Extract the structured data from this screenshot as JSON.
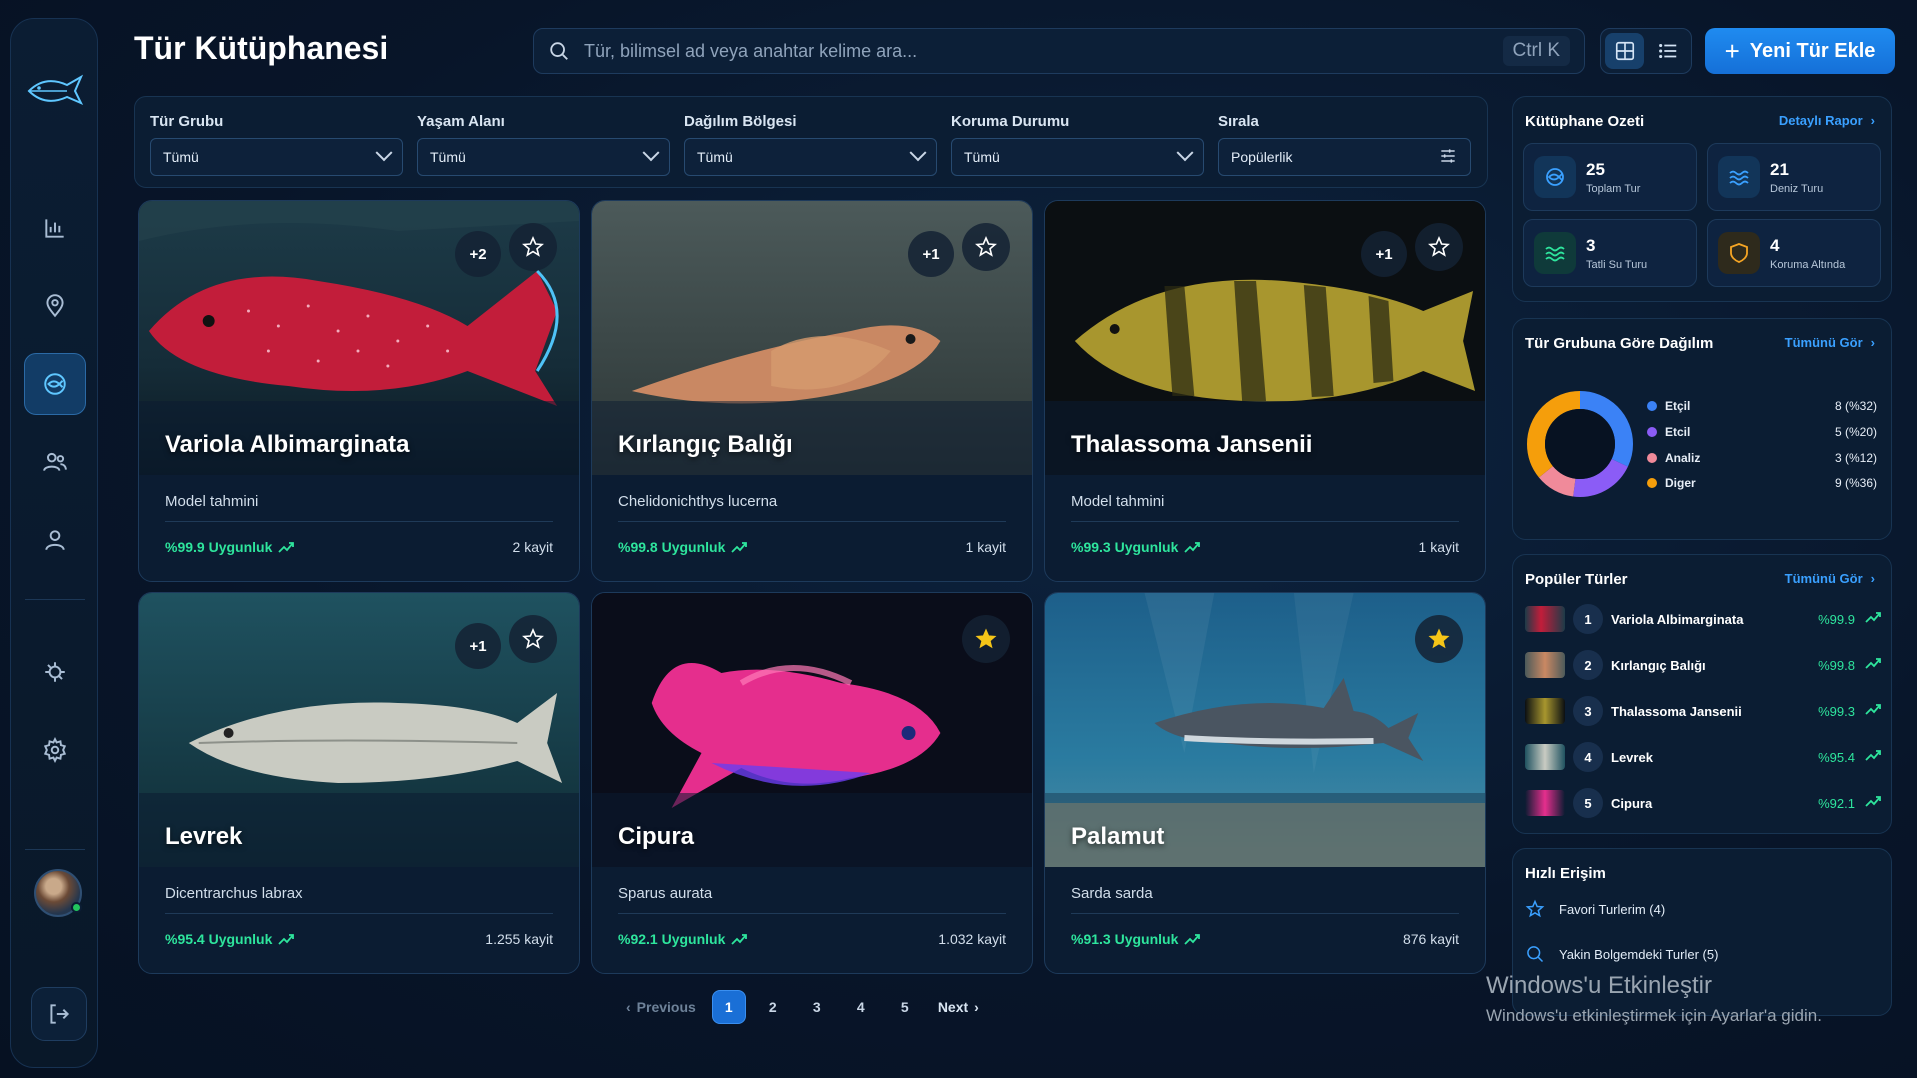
{
  "header": {
    "title": "Tür Kütüphanesi",
    "search_placeholder": "Tür, bilimsel ad veya anahtar kelime ara...",
    "search_shortcut": "Ctrl K",
    "add_button": "Yeni Tür Ekle"
  },
  "filters": [
    {
      "label": "Tür Grubu",
      "value": "Tümü"
    },
    {
      "label": "Yaşam Alanı",
      "value": "Tümü"
    },
    {
      "label": "Dağılım Bölgesi",
      "value": "Tümü"
    },
    {
      "label": "Koruma Durumu",
      "value": "Tümü"
    },
    {
      "label": "Sırala",
      "value": "Popülerlik"
    }
  ],
  "cards": [
    {
      "name": "Variola Albimarginata",
      "sci": "Model tahmini",
      "match": "%99.9 Uygunluk",
      "count": "2 kayit",
      "badge": "+2",
      "favorite": false
    },
    {
      "name": "Kırlangıç Balığı",
      "sci": "Chelidonichthys lucerna",
      "match": "%99.8 Uygunluk",
      "count": "1 kayit",
      "badge": "+1",
      "favorite": false
    },
    {
      "name": "Thalassoma Jansenii",
      "sci": "Model tahmini",
      "match": "%99.3 Uygunluk",
      "count": "1 kayit",
      "badge": "+1",
      "favorite": false
    },
    {
      "name": "Levrek",
      "sci": "Dicentrarchus labrax",
      "match": "%95.4 Uygunluk",
      "count": "1.255 kayit",
      "badge": "+1",
      "favorite": false
    },
    {
      "name": "Cipura",
      "sci": "Sparus aurata",
      "match": "%92.1 Uygunluk",
      "count": "1.032 kayit",
      "badge": "",
      "favorite": true
    },
    {
      "name": "Palamut",
      "sci": "Sarda sarda",
      "match": "%91.3 Uygunluk",
      "count": "876 kayit",
      "badge": "",
      "favorite": true
    }
  ],
  "pagination": {
    "prev": "Previous",
    "next": "Next",
    "pages": [
      "1",
      "2",
      "3",
      "4",
      "5"
    ],
    "current": "1"
  },
  "summary": {
    "title": "Kütüphane Ozeti",
    "link": "Detaylı Rapor",
    "stats": [
      {
        "value": "25",
        "label": "Toplam Tur",
        "icon": "fish-icon",
        "color": "#3aa0ff"
      },
      {
        "value": "21",
        "label": "Deniz Turu",
        "icon": "waves-icon",
        "color": "#3aa0ff"
      },
      {
        "value": "3",
        "label": "Tatli Su Turu",
        "icon": "water-icon",
        "color": "#2ee59d"
      },
      {
        "value": "4",
        "label": "Koruma Altında",
        "icon": "shield-icon",
        "color": "#f5a524"
      }
    ]
  },
  "distribution": {
    "title": "Tür Grubuna Göre Dağılım",
    "link": "Tümünü Gör",
    "items": [
      {
        "name": "Etçil",
        "value": "8",
        "pct": "(%32)",
        "color": "#3b82f6",
        "share": 32
      },
      {
        "name": "Etcil",
        "value": "5",
        "pct": "(%20)",
        "color": "#8b5cf6",
        "share": 20
      },
      {
        "name": "Analiz",
        "value": "3",
        "pct": "(%12)",
        "color": "#f08a9a",
        "share": 12
      },
      {
        "name": "Diger",
        "value": "9",
        "pct": "(%36)",
        "color": "#f59e0b",
        "share": 36
      }
    ]
  },
  "popular": {
    "title": "Popüler Türler",
    "link": "Tümünü Gör",
    "items": [
      {
        "rank": "1",
        "name": "Variola Albimarginata",
        "pct": "%99.9"
      },
      {
        "rank": "2",
        "name": "Kırlangıç Balığı",
        "pct": "%99.8"
      },
      {
        "rank": "3",
        "name": "Thalassoma Jansenii",
        "pct": "%99.3"
      },
      {
        "rank": "4",
        "name": "Levrek",
        "pct": "%95.4"
      },
      {
        "rank": "5",
        "name": "Cipura",
        "pct": "%92.1"
      }
    ]
  },
  "quick": {
    "title": "Hızlı Erişim",
    "items": [
      "Favori Turlerim (4)",
      "Yakin Bolgemdeki Turler (5)"
    ]
  },
  "watermark": {
    "line1": "Windows'u Etkinleştir",
    "line2": "Windows'u etkinleştirmek için Ayarlar'a gidin."
  }
}
